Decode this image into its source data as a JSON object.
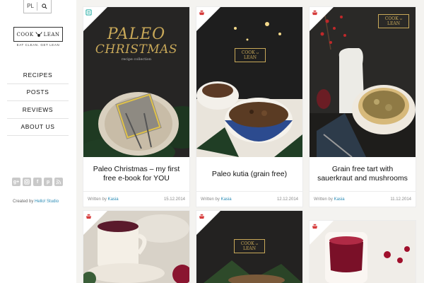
{
  "header": {
    "lang": "PL"
  },
  "logo": {
    "left": "COOK",
    "right": "LEAN",
    "tagline": "EAT CLEAN. GET LEAN"
  },
  "nav": [
    "RECIPES",
    "POSTS",
    "REVIEWS",
    "ABOUT US"
  ],
  "socials": [
    "g+",
    "ig",
    "f",
    "p",
    "rss"
  ],
  "footer": {
    "created_by": "Created by",
    "studio": "Hello! Studio"
  },
  "colors": {
    "accent_red": "#d63b3b",
    "link_blue": "#2a8bb5",
    "ebook_teal": "#2bb1a8"
  },
  "posts": [
    {
      "title": "Paleo Christmas – my first free e-book for YOU",
      "written_by": "Written by",
      "author": "Kasia",
      "date": "15.12.2014",
      "icon": "ebook-icon",
      "cover_title": "PALEO",
      "cover_title2": "CHRISTMAS",
      "cover_sub": "recipe collection"
    },
    {
      "title": "Paleo kutia (grain free)",
      "written_by": "Written by",
      "author": "Kasia",
      "date": "12.12.2014",
      "icon": "recipe-icon",
      "watermark_left": "COOK",
      "watermark_right": "LEAN"
    },
    {
      "title": "Grain free tart with sauerkraut and mushrooms",
      "written_by": "Written by",
      "author": "Kasia",
      "date": "11.12.2014",
      "icon": "recipe-icon",
      "watermark_left": "COOK",
      "watermark_right": "LEAN"
    },
    {
      "icon": "recipe-icon"
    },
    {
      "icon": "recipe-icon",
      "watermark_left": "COOK",
      "watermark_right": "LEAN"
    },
    {
      "icon": "recipe-icon"
    }
  ]
}
